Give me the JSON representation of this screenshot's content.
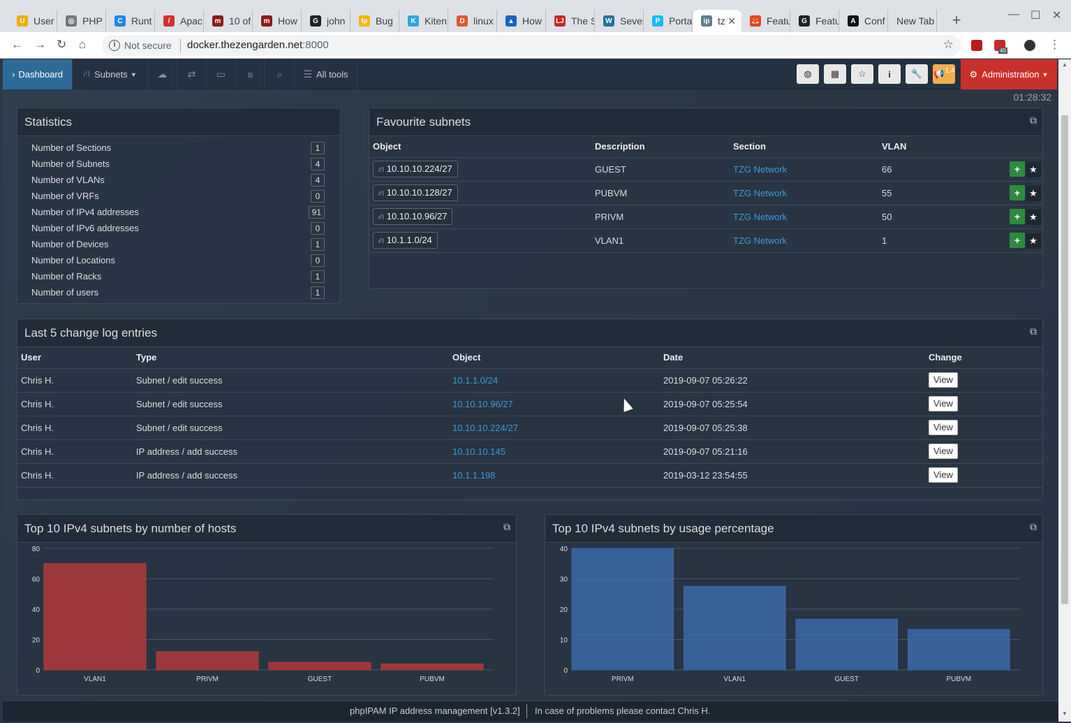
{
  "browser": {
    "tabs": [
      {
        "title": "User",
        "favicon_color": "#f0ad00",
        "favicon_char": "U"
      },
      {
        "title": "PHP",
        "favicon_color": "#777",
        "favicon_char": "◎"
      },
      {
        "title": "Runt",
        "favicon_color": "#1e88e5",
        "favicon_char": "C"
      },
      {
        "title": "Apac",
        "favicon_color": "#d32f2f",
        "favicon_char": "/"
      },
      {
        "title": "10 of",
        "favicon_color": "#8b1a1a",
        "favicon_char": "m"
      },
      {
        "title": "How",
        "favicon_color": "#8b1a1a",
        "favicon_char": "m"
      },
      {
        "title": "john",
        "favicon_color": "#222",
        "favicon_char": "G"
      },
      {
        "title": "Bug",
        "favicon_color": "#f5b700",
        "favicon_char": "lp"
      },
      {
        "title": "Kiten",
        "favicon_color": "#2aa8e0",
        "favicon_char": "K"
      },
      {
        "title": "linux",
        "favicon_color": "#de5833",
        "favicon_char": "D"
      },
      {
        "title": "How",
        "favicon_color": "#1565c0",
        "favicon_char": "▲"
      },
      {
        "title": "The S",
        "favicon_color": "#c62828",
        "favicon_char": "LJ"
      },
      {
        "title": "Sever",
        "favicon_color": "#21759b",
        "favicon_char": "W"
      },
      {
        "title": "Porta",
        "favicon_color": "#13bef9",
        "favicon_char": "P"
      },
      {
        "title": "tz",
        "favicon_color": "#607d8b",
        "favicon_char": "ip",
        "active": true
      },
      {
        "title": "Featu",
        "favicon_color": "#e24329",
        "favicon_char": "🦊"
      },
      {
        "title": "Featu",
        "favicon_color": "#222",
        "favicon_char": "G"
      },
      {
        "title": "Conf",
        "favicon_color": "#111",
        "favicon_char": "A"
      },
      {
        "title": "New Tab",
        "favicon_color": "",
        "favicon_char": ""
      }
    ],
    "security_label": "Not secure",
    "url_host": "docker.thezengarden.net",
    "url_port": ":8000",
    "ext_badge": "40"
  },
  "nav": {
    "dashboard": "Dashboard",
    "subnets": "Subnets",
    "all_tools": "All tools",
    "admin": "Administration",
    "update_badge": "1.4"
  },
  "clock": "01:28:32",
  "statistics": {
    "title": "Statistics",
    "rows": [
      {
        "label": "Number of Sections",
        "value": "1"
      },
      {
        "label": "Number of Subnets",
        "value": "4"
      },
      {
        "label": "Number of VLANs",
        "value": "4"
      },
      {
        "label": "Number of VRFs",
        "value": "0"
      },
      {
        "label": "Number of IPv4 addresses",
        "value": "91"
      },
      {
        "label": "Number of IPv6 addresses",
        "value": "0"
      },
      {
        "label": "Number of Devices",
        "value": "1"
      },
      {
        "label": "Number of Locations",
        "value": "0"
      },
      {
        "label": "Number of Racks",
        "value": "1"
      },
      {
        "label": "Number of users",
        "value": "1"
      }
    ]
  },
  "favourites": {
    "title": "Favourite subnets",
    "headers": [
      "Object",
      "Description",
      "Section",
      "VLAN"
    ],
    "rows": [
      {
        "object": "10.10.10.224/27",
        "description": "GUEST",
        "section": "TZG Network",
        "vlan": "66"
      },
      {
        "object": "10.10.10.128/27",
        "description": "PUBVM",
        "section": "TZG Network",
        "vlan": "55"
      },
      {
        "object": "10.10.10.96/27",
        "description": "PRIVM",
        "section": "TZG Network",
        "vlan": "50"
      },
      {
        "object": "10.1.1.0/24",
        "description": "VLAN1",
        "section": "TZG Network",
        "vlan": "1"
      }
    ]
  },
  "changelog": {
    "title": "Last 5 change log entries",
    "headers": [
      "User",
      "Type",
      "Object",
      "Date",
      "Change"
    ],
    "view_label": "View",
    "rows": [
      {
        "user": "Chris H.",
        "type": "Subnet / edit success",
        "object": "10.1.1.0/24",
        "date": "2019-09-07 05:26:22"
      },
      {
        "user": "Chris H.",
        "type": "Subnet / edit success",
        "object": "10.10.10.96/27",
        "date": "2019-09-07 05:25:54"
      },
      {
        "user": "Chris H.",
        "type": "Subnet / edit success",
        "object": "10.10.10.224/27",
        "date": "2019-09-07 05:25:38"
      },
      {
        "user": "Chris H.",
        "type": "IP address / add success",
        "object": "10.10.10.145",
        "date": "2019-09-07 05:21:16"
      },
      {
        "user": "Chris H.",
        "type": "IP address / add success",
        "object": "10.1.1.198",
        "date": "2019-03-12 23:54:55"
      }
    ]
  },
  "chart_data": [
    {
      "type": "bar",
      "title": "Top 10 IPv4 subnets by number of hosts",
      "categories": [
        "VLAN1",
        "PRIVM",
        "GUEST",
        "PUBVM"
      ],
      "values": [
        70,
        12,
        5,
        4
      ],
      "ylim": [
        0,
        80
      ],
      "yticks": [
        0,
        20,
        40,
        60,
        80
      ],
      "color": "#b03a3a",
      "grid": true
    },
    {
      "type": "bar",
      "title": "Top 10 IPv4 subnets by usage percentage",
      "categories": [
        "PRIVM",
        "VLAN1",
        "GUEST",
        "PUBVM"
      ],
      "values": [
        40,
        27.5,
        16.7,
        13.3
      ],
      "ylim": [
        0,
        40
      ],
      "yticks": [
        0,
        10,
        20,
        30,
        40
      ],
      "color": "#3a6aa8",
      "grid": true
    }
  ],
  "footer": {
    "text": "phpIPAM IP address management [v1.3.2]",
    "contact": "In case of problems please contact Chris H."
  }
}
